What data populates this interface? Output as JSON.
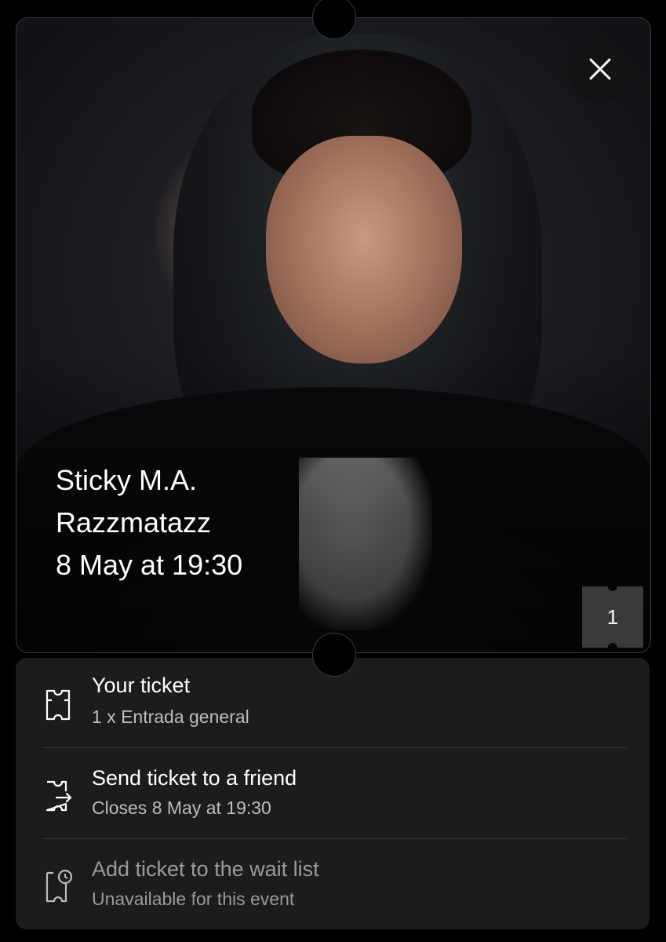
{
  "event": {
    "artist": "Sticky M.A.",
    "venue": "Razzmatazz",
    "datetime": "8 May at 19:30",
    "ticket_count": "1"
  },
  "options": [
    {
      "title": "Your ticket",
      "subtitle": "1 x Entrada general",
      "icon": "ticket-icon",
      "enabled": true
    },
    {
      "title": "Send ticket to a friend",
      "subtitle": "Closes 8 May at 19:30",
      "icon": "send-ticket-icon",
      "enabled": true
    },
    {
      "title": "Add ticket to the wait list",
      "subtitle": "Unavailable for this event",
      "icon": "waitlist-clock-icon",
      "enabled": false
    }
  ],
  "colors": {
    "background": "#000000",
    "panel": "#1c1c1e",
    "text": "#ffffff",
    "muted": "#bdbdbd",
    "disabled": "#9a9a9c"
  }
}
